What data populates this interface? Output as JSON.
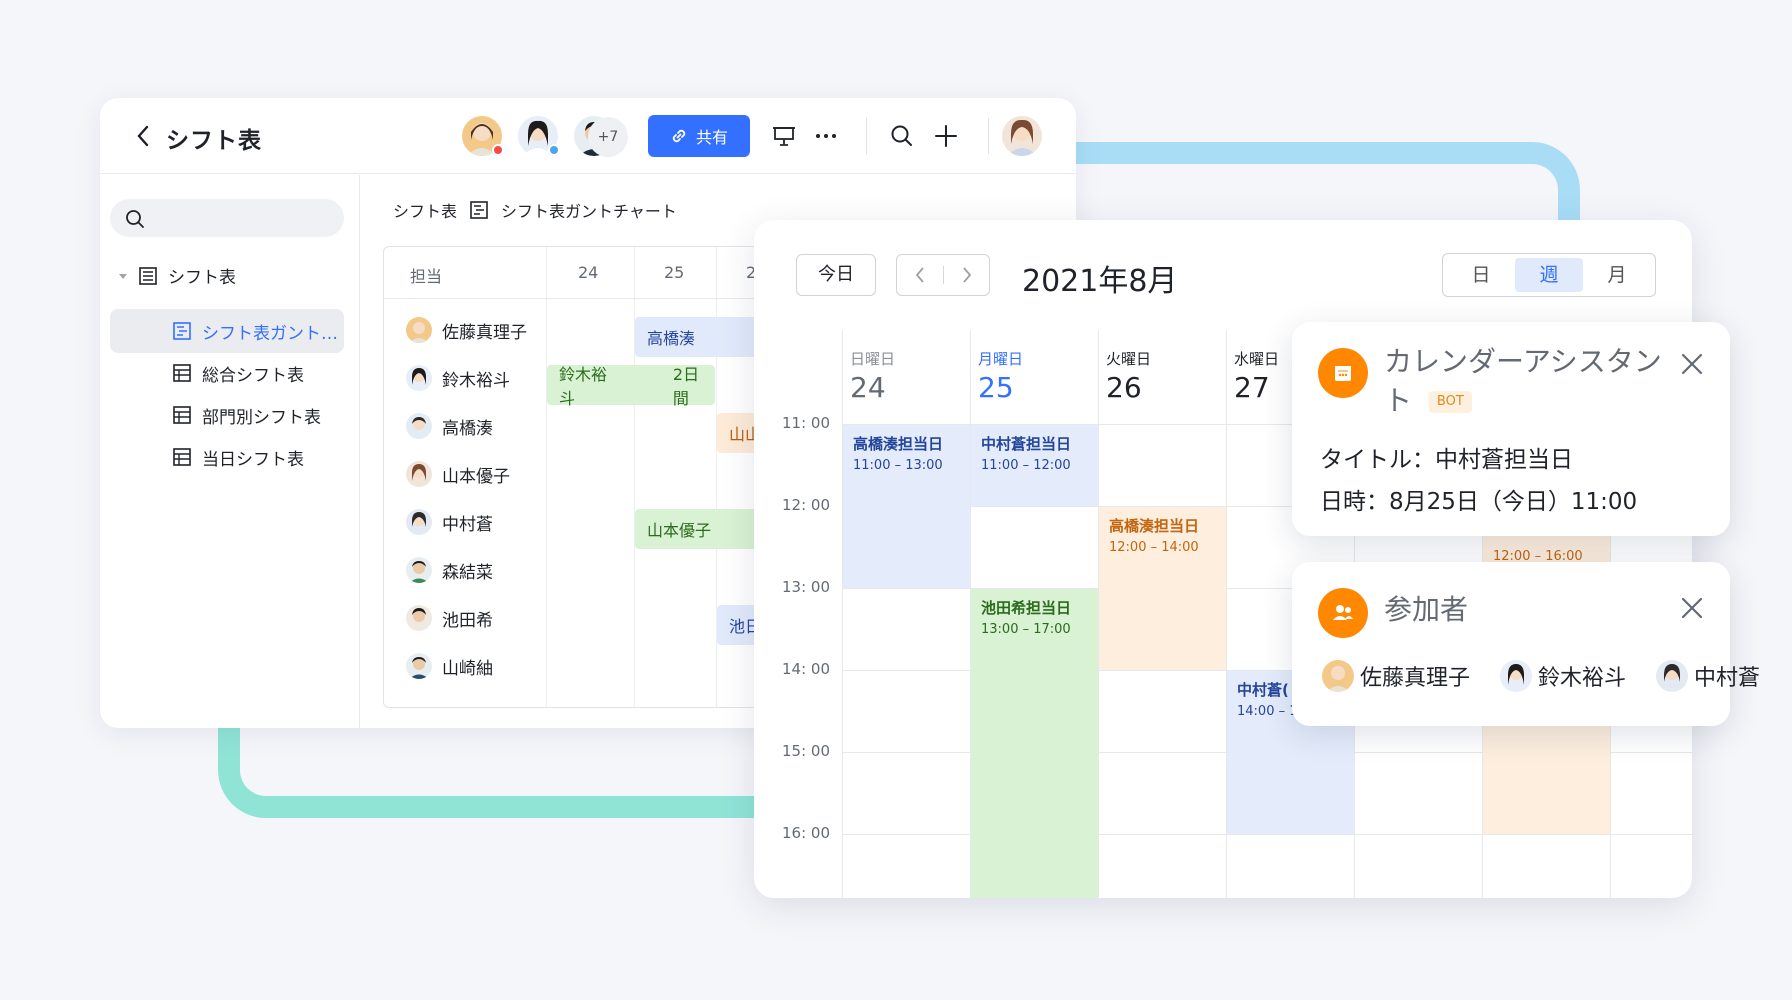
{
  "header": {
    "title": "シフト表",
    "more_count": "+7",
    "share_label": "共有"
  },
  "sidebar": {
    "root_label": "シフト表",
    "items": [
      {
        "label": "シフト表ガント…",
        "active": true
      },
      {
        "label": "総合シフト表"
      },
      {
        "label": "部門別シフト表"
      },
      {
        "label": "当日シフト表"
      }
    ]
  },
  "breadcrumb": {
    "parent": "シフト表",
    "current": "シフト表ガントチャート"
  },
  "gantt": {
    "owner_header": "担当",
    "date_headers": [
      "24",
      "25",
      "2"
    ],
    "people": [
      "佐藤真理子",
      "鈴木裕斗",
      "高橋湊",
      "山本優子",
      "中村蒼",
      "森結菜",
      "池田希",
      "山崎紬"
    ],
    "bars": [
      {
        "label": "高橋湊",
        "extra": ""
      },
      {
        "label": "鈴木裕斗",
        "extra": "2日間"
      },
      {
        "label": "山山",
        "extra": ""
      },
      {
        "label": "山本優子",
        "extra": ""
      },
      {
        "label": "池日",
        "extra": ""
      }
    ]
  },
  "calendar": {
    "today_label": "今日",
    "month_label": "2021年8月",
    "views": [
      "日",
      "週",
      "月"
    ],
    "active_view": "週",
    "days": [
      {
        "weekday": "日曜日",
        "date": "24"
      },
      {
        "weekday": "月曜日",
        "date": "25"
      },
      {
        "weekday": "火曜日",
        "date": "26"
      },
      {
        "weekday": "水曜日",
        "date": "27"
      }
    ],
    "times": [
      "11: 00",
      "12: 00",
      "13: 00",
      "14: 00",
      "15: 00",
      "16: 00"
    ],
    "events": [
      {
        "title": "高橋湊担当日",
        "time": "11:00 – 13:00"
      },
      {
        "title": "中村蒼担当日",
        "time": "11:00 – 12:00"
      },
      {
        "title": "高橋湊担当日",
        "time": "12:00 – 14:00"
      },
      {
        "title": "池田希担当日",
        "time": "13:00 – 17:00"
      },
      {
        "title": "中村蒼(",
        "time": "14:00 – 1"
      },
      {
        "title": "",
        "time": "12:00 – 16:00"
      }
    ]
  },
  "assistant": {
    "title": "カレンダーアシスタント",
    "badge": "BOT",
    "title_line": "タイトル：中村蒼担当日",
    "date_line": "日時：8月25日（今日）11:00"
  },
  "participants": {
    "title": "参加者",
    "names": [
      "佐藤真理子",
      "鈴木裕斗",
      "中村蒼"
    ]
  },
  "colors": {
    "accent": "#3370ff",
    "bot_orange": "#ff8800",
    "event_blue": "#e4ecfb",
    "event_green": "#d9f2d3",
    "event_orange": "#fdeedd"
  }
}
